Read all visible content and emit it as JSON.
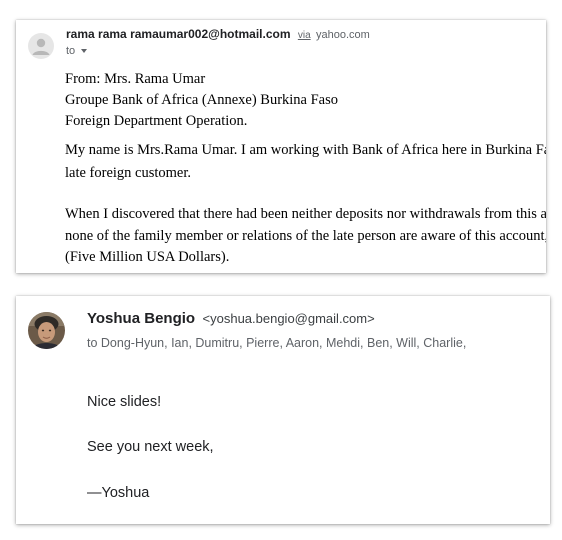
{
  "email1": {
    "sender_name": "rama rama",
    "sender_email": "ramaumar002@hotmail.com",
    "via_label": "via",
    "via_domain": "yahoo.com",
    "to_label": "to",
    "avatar_icon": "person-icon",
    "body_lines": [
      "From: Mrs. Rama Umar",
      "Groupe Bank of Africa (Annexe) Burkina Faso",
      "Foreign Department Operation.",
      "My name is Mrs.Rama Umar. I am working with Bank of Africa here in Burkina Fas",
      "late foreign customer.",
      "When I discovered that there had been neither deposits nor withdrawals from this ac",
      "none of the family member or relations of the late person are aware of this account, ",
      "(Five Million USA Dollars)."
    ]
  },
  "email2": {
    "sender_name": "Yoshua Bengio",
    "sender_email": "<yoshua.bengio@gmail.com>",
    "to_line": "to Dong-Hyun, Ian, Dumitru, Pierre, Aaron, Mehdi, Ben, Will, Charlie,",
    "avatar_icon": "profile-photo",
    "body_lines": [
      "Nice slides!",
      "See you next week,",
      "—Yoshua"
    ]
  },
  "colors": {
    "primary_text": "#202124",
    "secondary_text": "#5f6368",
    "avatar_bg": "#e6e6e6"
  }
}
